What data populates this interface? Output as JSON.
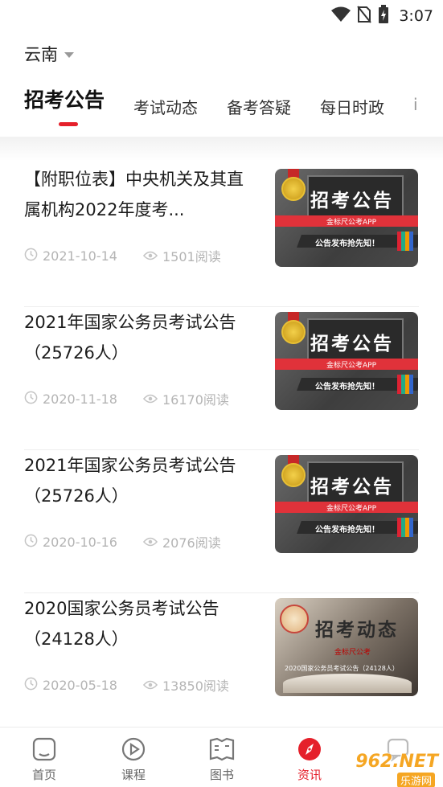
{
  "status_bar": {
    "time": "3:07"
  },
  "region": {
    "label": "云南"
  },
  "tabs": [
    {
      "label": "招考公告",
      "active": true
    },
    {
      "label": "考试动态"
    },
    {
      "label": "备考答疑"
    },
    {
      "label": "每日时政"
    },
    {
      "label": "i"
    }
  ],
  "accent_color": "#e5202b",
  "news": [
    {
      "title": "【附职位表】中央机关及其直属机构2022年度考...",
      "date": "2021-10-14",
      "views": "1501阅读",
      "thumb": {
        "headline": "招考公告",
        "app_label": "金标尺公考APP",
        "slogan": "公告发布抢先知！"
      }
    },
    {
      "title": "2021年国家公务员考试公告（25726人）",
      "date": "2020-11-18",
      "views": "16170阅读",
      "thumb": {
        "headline": "招考公告",
        "app_label": "金标尺公考APP",
        "slogan": "公告发布抢先知！"
      }
    },
    {
      "title": "2021年国家公务员考试公告（25726人）",
      "date": "2020-10-16",
      "views": "2076阅读",
      "thumb": {
        "headline": "招考公告",
        "app_label": "金标尺公考APP",
        "slogan": "公告发布抢先知！"
      }
    },
    {
      "title": "2020国家公务员考试公告（24128人）",
      "date": "2020-05-18",
      "views": "13850阅读",
      "thumb": {
        "headline": "招考动态",
        "app_label": "金标尺公考",
        "medal_text": "金标尺公考",
        "slogan": "2020国家公务员考试公告（24128人）"
      }
    }
  ],
  "bottom_nav": [
    {
      "label": "首页",
      "icon": "home-icon"
    },
    {
      "label": "课程",
      "icon": "play-icon"
    },
    {
      "label": "图书",
      "icon": "book-icon"
    },
    {
      "label": "资讯",
      "icon": "compass-icon",
      "active": true
    },
    {
      "label": "",
      "icon": "chat-icon"
    }
  ],
  "watermark": {
    "text": "962.NET",
    "sub": "乐游网"
  }
}
